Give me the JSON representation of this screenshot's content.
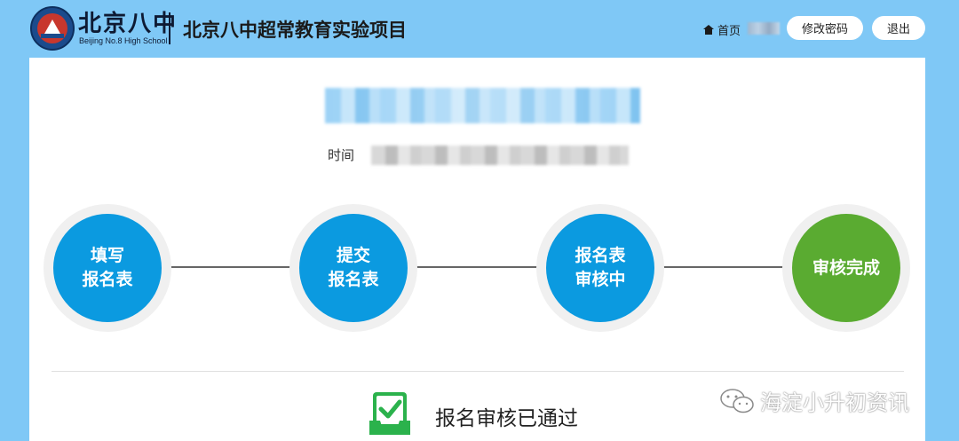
{
  "header": {
    "school_name_cn": "北京八中",
    "school_name_en": "Beijing No.8 High School",
    "project_title": "北京八中超常教育实验项目",
    "home_label": "首页",
    "change_password_label": "修改密码",
    "logout_label": "退出"
  },
  "main": {
    "time_label": "时间",
    "steps": [
      {
        "label": "填写\n报名表",
        "color": "#0b9ae0"
      },
      {
        "label": "提交\n报名表",
        "color": "#0b9ae0"
      },
      {
        "label": "报名表\n审核中",
        "color": "#0b9ae0"
      },
      {
        "label": "审核完成",
        "color": "#5aab31"
      }
    ],
    "status_text": "报名审核已通过"
  },
  "watermark": {
    "text": "海淀小升初资讯"
  },
  "colors": {
    "header_bg": "#7fc8f6",
    "step_blue": "#0b9ae0",
    "step_green": "#5aab31",
    "check_green": "#2bb24c"
  }
}
